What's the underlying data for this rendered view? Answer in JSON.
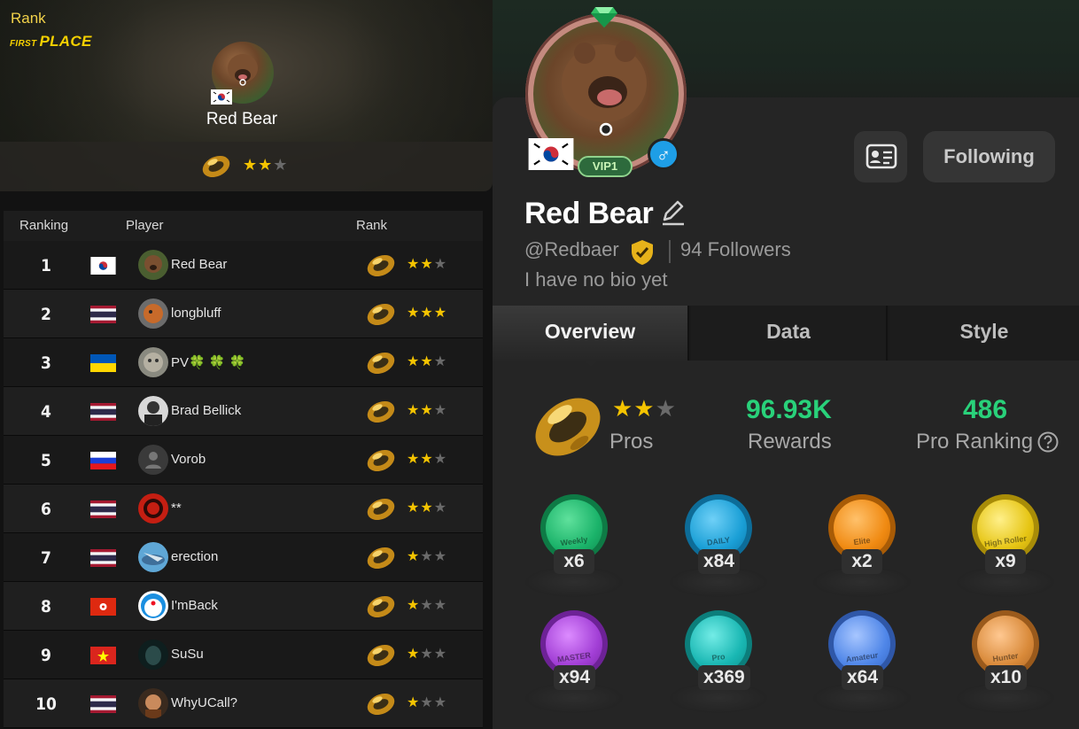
{
  "left": {
    "hero": {
      "title": "Rank",
      "first_place_small": "FIRST ",
      "first_place_big": "PLACE",
      "player_name": "Red Bear",
      "stars": "★★★"
    },
    "table": {
      "headers": {
        "ranking": "Ranking",
        "player": "Player",
        "rank": "Rank"
      },
      "rows": [
        {
          "rank": "1",
          "name": "Red Bear",
          "flag": "kr",
          "stars_on": "★★",
          "stars_off": "★"
        },
        {
          "rank": "2",
          "name": "longbluff",
          "flag": "th",
          "stars_on": "★★★",
          "stars_off": ""
        },
        {
          "rank": "3",
          "name": "PV🍀 🍀 🍀",
          "flag": "ua",
          "stars_on": "★★",
          "stars_off": "★"
        },
        {
          "rank": "4",
          "name": "Brad Bellick",
          "flag": "th",
          "stars_on": "★★",
          "stars_off": "★"
        },
        {
          "rank": "5",
          "name": "Vorob",
          "flag": "ru",
          "stars_on": "★★",
          "stars_off": "★"
        },
        {
          "rank": "6",
          "name": "**",
          "flag": "th",
          "stars_on": "★★",
          "stars_off": "★"
        },
        {
          "rank": "7",
          "name": "erection",
          "flag": "th",
          "stars_on": "★",
          "stars_off": "★★"
        },
        {
          "rank": "8",
          "name": "I'mBack",
          "flag": "hk",
          "stars_on": "★",
          "stars_off": "★★"
        },
        {
          "rank": "9",
          "name": "SuSu",
          "flag": "vn",
          "stars_on": "★",
          "stars_off": "★★"
        },
        {
          "rank": "10",
          "name": "WhyUCall?",
          "flag": "th",
          "stars_on": "★",
          "stars_off": "★★"
        }
      ]
    }
  },
  "profile": {
    "vip": "VIP1",
    "name": "Red Bear",
    "handle": "@Redbaer",
    "followers": "94 Followers",
    "bio": "I have no bio yet",
    "follow_button": "Following",
    "tabs": [
      "Overview",
      "Data",
      "Style"
    ],
    "stats": {
      "rank_label": "Pros",
      "rank_stars_on": "★★",
      "rank_stars_off": "★",
      "rewards_value": "96.93K",
      "rewards_label": "Rewards",
      "ranking_value": "486",
      "ranking_label": "Pro Ranking"
    },
    "medals": [
      {
        "label": "Weekly",
        "count": "x6",
        "color": "#1bb36a"
      },
      {
        "label": "DAILY",
        "count": "x84",
        "color": "#1a9fd6"
      },
      {
        "label": "Elite",
        "count": "x2",
        "color": "#f08a12"
      },
      {
        "label": "High Roller",
        "count": "x9",
        "color": "#e6c514"
      },
      {
        "label": "MASTER",
        "count": "x94",
        "color": "#a23fd6"
      },
      {
        "label": "Pro",
        "count": "x369",
        "color": "#19b7b3"
      },
      {
        "label": "Amateur",
        "count": "x64",
        "color": "#4f86e8"
      },
      {
        "label": "Hunter",
        "count": "x10",
        "color": "#d98a3a"
      }
    ]
  },
  "colors": {
    "accent_green": "#29d17a",
    "star_gold": "#f5c400",
    "title_yellow": "#f2d24a"
  }
}
